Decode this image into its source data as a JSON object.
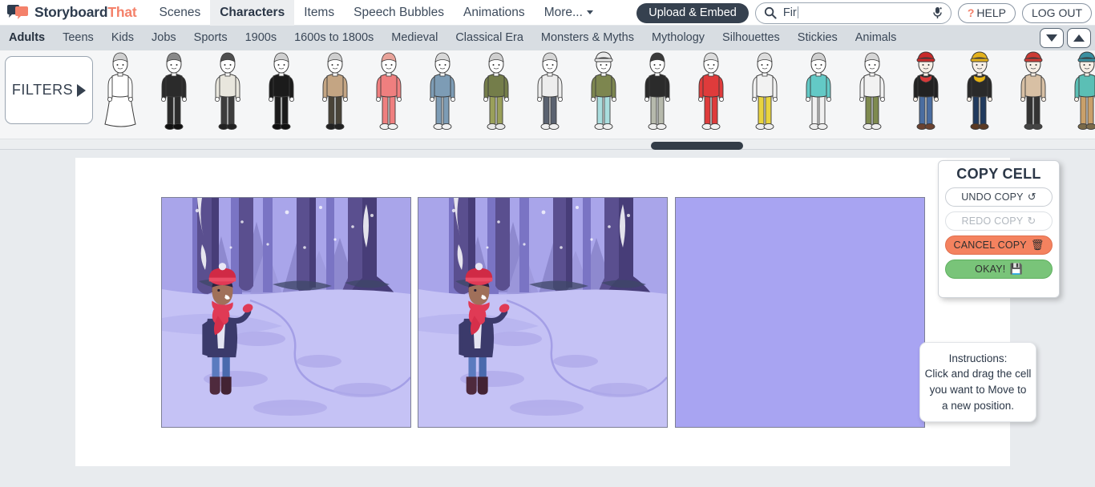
{
  "brand": {
    "name_part1": "Storyboard",
    "name_part2": "That",
    "color_dark": "#2e3c4e",
    "color_accent": "#f4816a"
  },
  "header": {
    "nav": [
      {
        "label": "Scenes",
        "active": false
      },
      {
        "label": "Characters",
        "active": true
      },
      {
        "label": "Items",
        "active": false
      },
      {
        "label": "Speech Bubbles",
        "active": false
      },
      {
        "label": "Animations",
        "active": false
      },
      {
        "label": "More...",
        "active": false,
        "has_caret": true
      }
    ],
    "upload_label": "Upload & Embed",
    "search": {
      "value": "Fir",
      "placeholder": "",
      "icon": "search-icon",
      "mic_icon": "microphone-icon"
    },
    "help_label": "HELP",
    "help_prefix": "?",
    "logout_label": "LOG OUT"
  },
  "subnav": {
    "items": [
      {
        "label": "Adults",
        "active": true
      },
      {
        "label": "Teens",
        "active": false
      },
      {
        "label": "Kids",
        "active": false
      },
      {
        "label": "Jobs",
        "active": false
      },
      {
        "label": "Sports",
        "active": false
      },
      {
        "label": "1900s",
        "active": false
      },
      {
        "label": "1600s to 1800s",
        "active": false
      },
      {
        "label": "Medieval",
        "active": false
      },
      {
        "label": "Classical Era",
        "active": false
      },
      {
        "label": "Monsters & Myths",
        "active": false
      },
      {
        "label": "Mythology",
        "active": false
      },
      {
        "label": "Silhouettes",
        "active": false
      },
      {
        "label": "Stickies",
        "active": false
      },
      {
        "label": "Animals",
        "active": false
      }
    ],
    "scroll_down_icon": "chevron-down-icon",
    "scroll_up_icon": "chevron-up-icon"
  },
  "library": {
    "filters_label": "FILTERS",
    "filters_icon": "play-triangle-icon",
    "characters": [
      {
        "name": "bride-white-dress",
        "skin": "#ffffff",
        "hair": "#cfcfcf",
        "top": "#ffffff",
        "bottom": "#ffffff",
        "shoe": "#ffffff",
        "hat": "",
        "long": true
      },
      {
        "name": "groom-black-tuxedo",
        "skin": "#ffffff",
        "hair": "#888888",
        "top": "#2b2b2b",
        "bottom": "#2b2b2b",
        "shoe": "#111111",
        "hat": ""
      },
      {
        "name": "man-grey-suit",
        "skin": "#ffffff",
        "hair": "#4f4f4f",
        "top": "#e8e6dd",
        "bottom": "#3d3d3d",
        "shoe": "#222222",
        "hat": ""
      },
      {
        "name": "priest-black-robe",
        "skin": "#ffffff",
        "hair": "#cfcfcf",
        "top": "#1b1b1b",
        "bottom": "#1b1b1b",
        "shoe": "#111111",
        "hat": ""
      },
      {
        "name": "man-tan-trenchcoat",
        "skin": "#ffffff",
        "hair": "#cfcfcf",
        "top": "#c4a583",
        "bottom": "#4a4438",
        "shoe": "#222222",
        "hat": ""
      },
      {
        "name": "woman-pink-robe",
        "skin": "#ffffff",
        "hair": "#e8a39a",
        "top": "#ef7f7f",
        "bottom": "#ef7f7f",
        "shoe": "#f2f2f2",
        "hat": ""
      },
      {
        "name": "man-blue-robe",
        "skin": "#ffffff",
        "hair": "#d8d8d8",
        "top": "#7d9cb5",
        "bottom": "#7d9cb5",
        "shoe": "#f2f2f2",
        "hat": ""
      },
      {
        "name": "woman-olive-top-plaid-pants",
        "skin": "#ffffff",
        "hair": "#cfcfcf",
        "top": "#747d4a",
        "bottom": "#9aa05a",
        "shoe": "#e9e9e9",
        "hat": ""
      },
      {
        "name": "man-white-shirt-grey-jeans",
        "skin": "#ffffff",
        "hair": "#d6d6d6",
        "top": "#ededed",
        "bottom": "#5a6270",
        "shoe": "#efefef",
        "hat": ""
      },
      {
        "name": "woman-olive-tank-mint-pants",
        "skin": "#ffffff",
        "hair": "#d6d6d6",
        "top": "#7d864f",
        "bottom": "#a9ddde",
        "shoe": "#efefef",
        "hat": "beanie"
      },
      {
        "name": "man-black-tshirt-grey-pants",
        "skin": "#ffffff",
        "hair": "#3a3a3a",
        "top": "#2b2b2b",
        "bottom": "#b6b9ac",
        "shoe": "#efefef",
        "hat": ""
      },
      {
        "name": "woman-red-dress",
        "skin": "#ffffff",
        "hair": "#dcdcdc",
        "top": "#df3b3b",
        "bottom": "#df3b3b",
        "shoe": "#f2f2f2",
        "hat": ""
      },
      {
        "name": "man-white-shirt-yellow-shorts",
        "skin": "#ffffff",
        "hair": "#dddddd",
        "top": "#f2f2f2",
        "bottom": "#e8d33f",
        "shoe": "#efefef",
        "hat": ""
      },
      {
        "name": "woman-teal-swimsuit",
        "skin": "#ffffff",
        "hair": "#cfcfcf",
        "top": "#63c9c6",
        "bottom": "#f0f0f0",
        "shoe": "#efefef",
        "hat": ""
      },
      {
        "name": "man-white-shirt-olive-shorts",
        "skin": "#ffffff",
        "hair": "#d6d6d6",
        "top": "#f2f2f2",
        "bottom": "#7e8a4f",
        "shoe": "#efefef",
        "hat": ""
      },
      {
        "name": "man-red-beanie-black-coat",
        "skin": "#f7efe6",
        "hair": "#6b4a32",
        "top": "#222222",
        "bottom": "#4a6da0",
        "shoe": "#6a4230",
        "hat": "#c92a2a",
        "scarf": "#d83a3a"
      },
      {
        "name": "man-yellow-beanie-scarf",
        "skin": "#f7efe6",
        "hair": "#d9a020",
        "top": "#2a2a2a",
        "bottom": "#203a5e",
        "shoe": "#5a3a24",
        "hat": "#e3b11c",
        "scarf": "#e8b411"
      },
      {
        "name": "woman-red-hat-tan-coat",
        "skin": "#f7efe6",
        "hair": "#eaeaea",
        "top": "#d8c0a4",
        "bottom": "#333333",
        "shoe": "#444444",
        "hat": "#cc3b35"
      },
      {
        "name": "woman-teal-jacket",
        "skin": "#f7efe6",
        "hair": "#6d8088",
        "top": "#5bbfb5",
        "bottom": "#c9a06a",
        "shoe": "#7a6a4a",
        "hat": "#3a8fa0"
      }
    ],
    "scrollbar": {
      "name": "horizontal-scrollbar"
    }
  },
  "storyboard": {
    "cells": [
      {
        "name": "cell-1",
        "type": "scene",
        "scene": "winter-forest-with-character",
        "empty": false
      },
      {
        "name": "cell-2",
        "type": "scene",
        "scene": "winter-forest-with-character",
        "empty": false
      },
      {
        "name": "cell-3",
        "type": "empty",
        "scene": "",
        "empty": true
      }
    ],
    "empty_cell_color": "#a8a4f2"
  },
  "copy_panel": {
    "title": "COPY CELL",
    "buttons": [
      {
        "label": "UNDO COPY",
        "glyph": "↺",
        "icon": "undo-icon",
        "style": "plain",
        "disabled": false
      },
      {
        "label": "REDO COPY",
        "glyph": "↻",
        "icon": "redo-icon",
        "style": "disabled",
        "disabled": true
      },
      {
        "label": "CANCEL COPY",
        "glyph": "🗑",
        "icon": "trash-icon",
        "style": "danger",
        "disabled": false
      },
      {
        "label": "OKAY!",
        "glyph": "💾",
        "icon": "save-disk-icon",
        "style": "ok",
        "disabled": false
      }
    ],
    "colors": {
      "danger": "#f4825f",
      "ok": "#79c479"
    }
  },
  "instructions": {
    "line1": "Instructions:",
    "line2": "Click and drag the cell",
    "line3": "you want to Move to",
    "line4": "a new position."
  }
}
